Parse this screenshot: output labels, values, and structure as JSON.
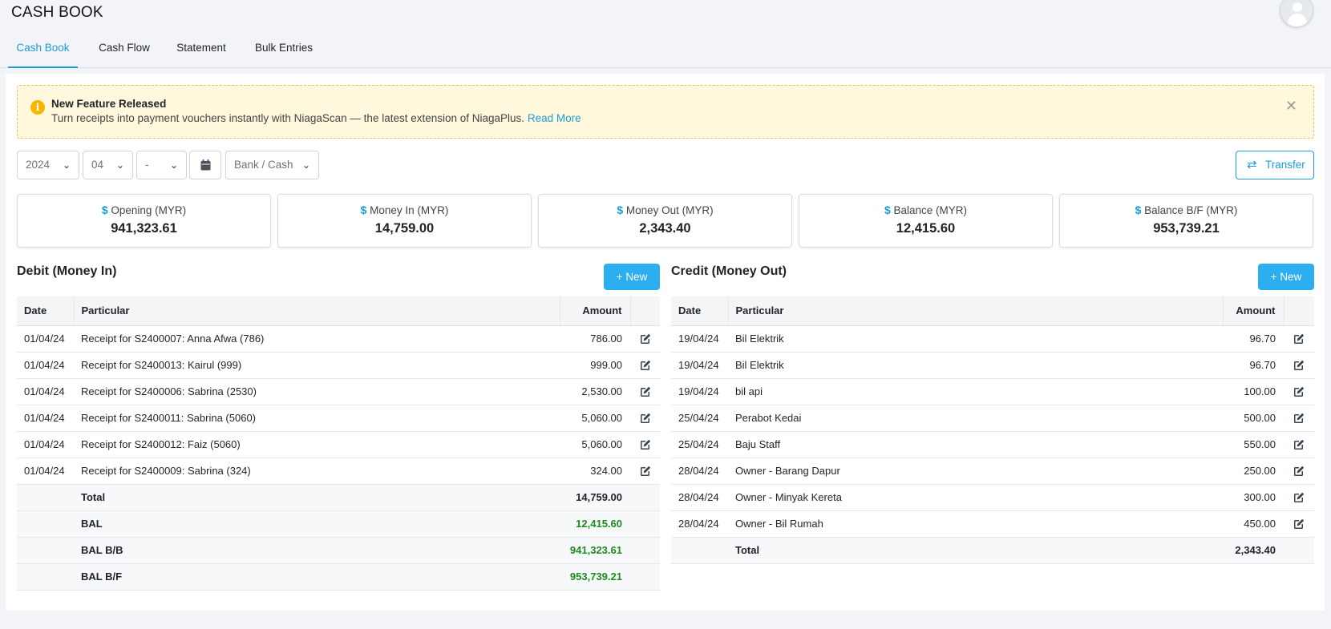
{
  "header": {
    "title": "CASH BOOK"
  },
  "tabs": [
    {
      "label": "Cash Book",
      "active": true
    },
    {
      "label": "Cash Flow",
      "active": false
    },
    {
      "label": "Statement",
      "active": false
    },
    {
      "label": "Bulk Entries",
      "active": false
    }
  ],
  "alert": {
    "title": "New Feature Released",
    "message": "Turn receipts into payment vouchers instantly with NiagaScan — the latest extension of NiagaPlus.",
    "link": "Read More"
  },
  "filters": {
    "year": "2024",
    "month": "04",
    "day": "-",
    "account": "Bank / Cash"
  },
  "transfer_label": "Transfer",
  "stats": [
    {
      "label": "Opening (MYR)",
      "value": "941,323.61"
    },
    {
      "label": "Money In (MYR)",
      "value": "14,759.00"
    },
    {
      "label": "Money Out (MYR)",
      "value": "2,343.40"
    },
    {
      "label": "Balance (MYR)",
      "value": "12,415.60"
    },
    {
      "label": "Balance B/F (MYR)",
      "value": "953,739.21"
    }
  ],
  "debit": {
    "title": "Debit (Money In)",
    "new_label": "New",
    "columns": [
      "Date",
      "Particular",
      "Amount"
    ],
    "rows": [
      {
        "date": "01/04/24",
        "particular": "Receipt for S2400007: Anna Afwa (786)",
        "amount": "786.00"
      },
      {
        "date": "01/04/24",
        "particular": "Receipt for S2400013: Kairul (999)",
        "amount": "999.00"
      },
      {
        "date": "01/04/24",
        "particular": "Receipt for S2400006: Sabrina (2530)",
        "amount": "2,530.00"
      },
      {
        "date": "01/04/24",
        "particular": "Receipt for S2400011: Sabrina (5060)",
        "amount": "5,060.00"
      },
      {
        "date": "01/04/24",
        "particular": "Receipt for S2400012: Faiz (5060)",
        "amount": "5,060.00"
      },
      {
        "date": "01/04/24",
        "particular": "Receipt for S2400009: Sabrina (324)",
        "amount": "324.00"
      }
    ],
    "summary": [
      {
        "label": "Total",
        "value": "14,759.00",
        "green": false
      },
      {
        "label": "BAL",
        "value": "12,415.60",
        "green": true
      },
      {
        "label": "BAL B/B",
        "value": "941,323.61",
        "green": true
      },
      {
        "label": "BAL B/F",
        "value": "953,739.21",
        "green": true
      }
    ]
  },
  "credit": {
    "title": "Credit (Money Out)",
    "new_label": "New",
    "columns": [
      "Date",
      "Particular",
      "Amount"
    ],
    "rows": [
      {
        "date": "19/04/24",
        "particular": "Bil Elektrik",
        "amount": "96.70"
      },
      {
        "date": "19/04/24",
        "particular": "Bil Elektrik",
        "amount": "96.70"
      },
      {
        "date": "19/04/24",
        "particular": "bil api",
        "amount": "100.00"
      },
      {
        "date": "25/04/24",
        "particular": "Perabot Kedai",
        "amount": "500.00"
      },
      {
        "date": "25/04/24",
        "particular": "Baju Staff",
        "amount": "550.00"
      },
      {
        "date": "28/04/24",
        "particular": "Owner - Barang Dapur",
        "amount": "250.00"
      },
      {
        "date": "28/04/24",
        "particular": "Owner - Minyak Kereta",
        "amount": "300.00"
      },
      {
        "date": "28/04/24",
        "particular": "Owner - Bil Rumah",
        "amount": "450.00"
      }
    ],
    "summary": [
      {
        "label": "Total",
        "value": "2,343.40",
        "green": false
      }
    ]
  },
  "colors": {
    "accent": "#1e9bd7",
    "button": "#2daef0",
    "positive": "#1f8a1f",
    "alert_bg": "#fff8dc"
  }
}
